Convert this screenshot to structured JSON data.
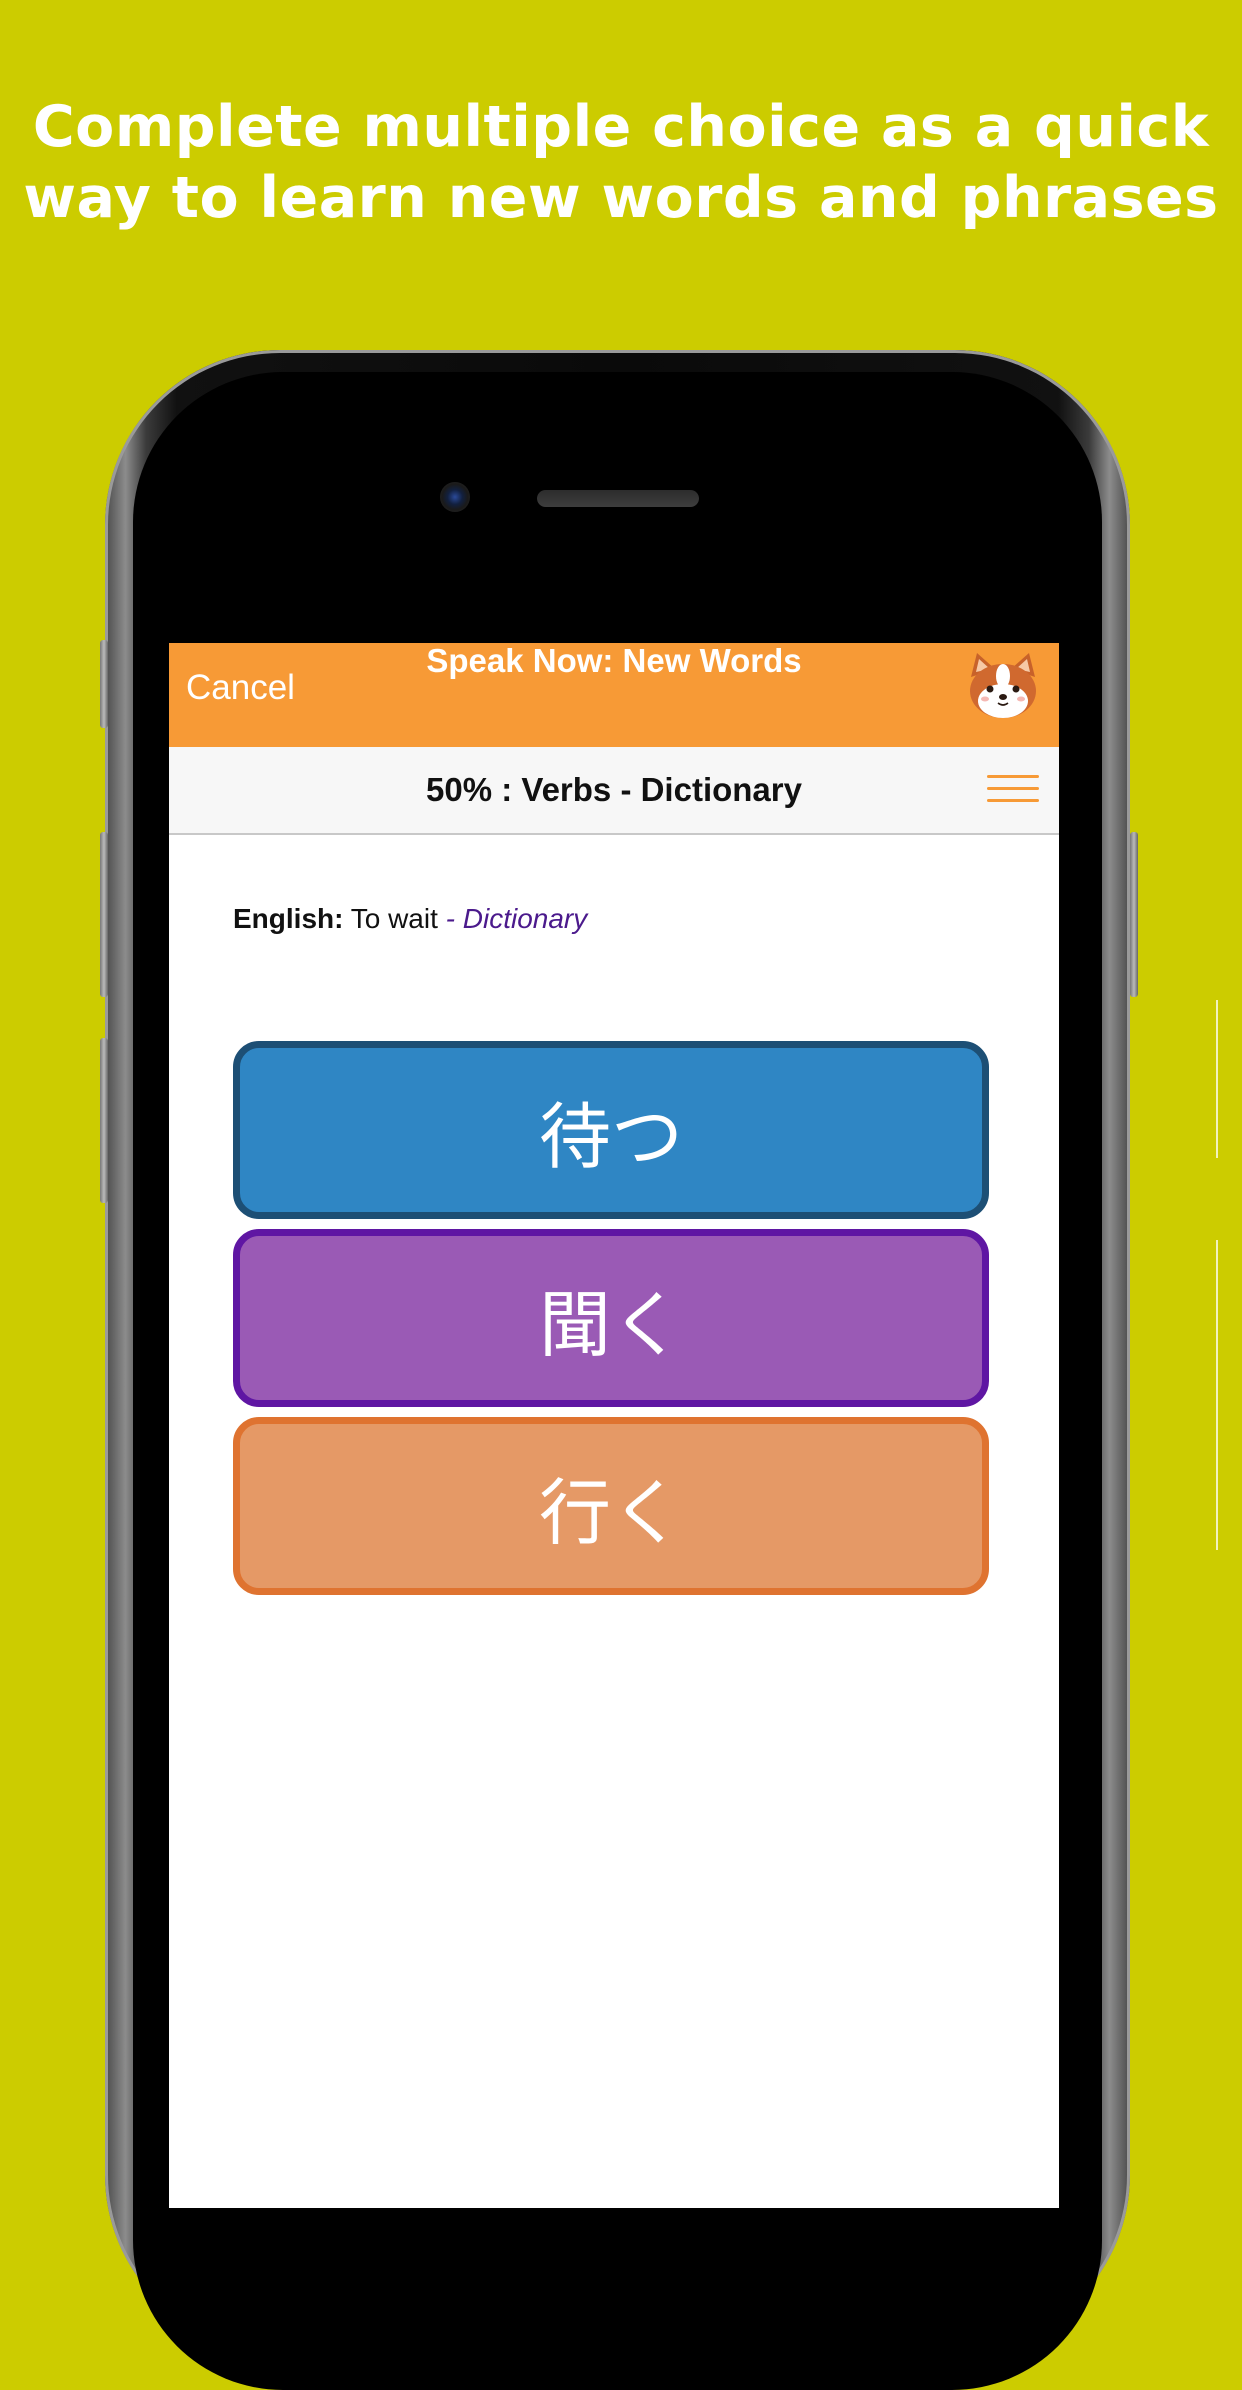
{
  "headline": {
    "line1": "Complete multiple choice as a quick",
    "line2": "way to learn new words and phrases"
  },
  "colors": {
    "background": "#cccc00",
    "navbar": "#f79a36",
    "choice_blue": "#2f86c4",
    "choice_purple": "#9a5ab5",
    "choice_orange": "#e59966"
  },
  "navbar": {
    "cancel_label": "Cancel",
    "title": "Speak Now: New Words",
    "avatar_icon": "shiba-dog-avatar-icon"
  },
  "subbar": {
    "title": "50% : Verbs - Dictionary",
    "menu_icon": "hamburger-menu-icon"
  },
  "prompt": {
    "label": "English:",
    "text": "To wait",
    "category": "- Dictionary"
  },
  "choices": [
    {
      "label": "待つ"
    },
    {
      "label": "聞く"
    },
    {
      "label": "行く"
    }
  ]
}
